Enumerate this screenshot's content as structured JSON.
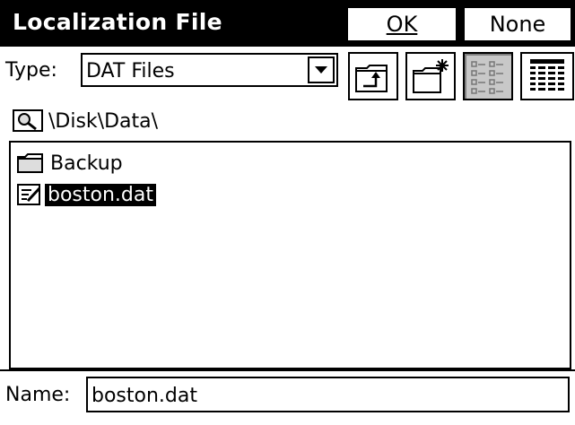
{
  "title": "Localization File",
  "buttons": {
    "ok": "OK",
    "none": "None"
  },
  "type_field": {
    "label": "Type:",
    "value": "DAT Files"
  },
  "toolbar": [
    "up-folder-icon",
    "new-folder-icon",
    "list-view-icon",
    "details-view-icon"
  ],
  "path": "\\Disk\\Data\\",
  "files": [
    {
      "name": "Backup",
      "icon": "folder-icon",
      "selected": false
    },
    {
      "name": "boston.dat",
      "icon": "document-icon",
      "selected": true
    }
  ],
  "name_field": {
    "label": "Name:",
    "value": "boston.dat"
  }
}
